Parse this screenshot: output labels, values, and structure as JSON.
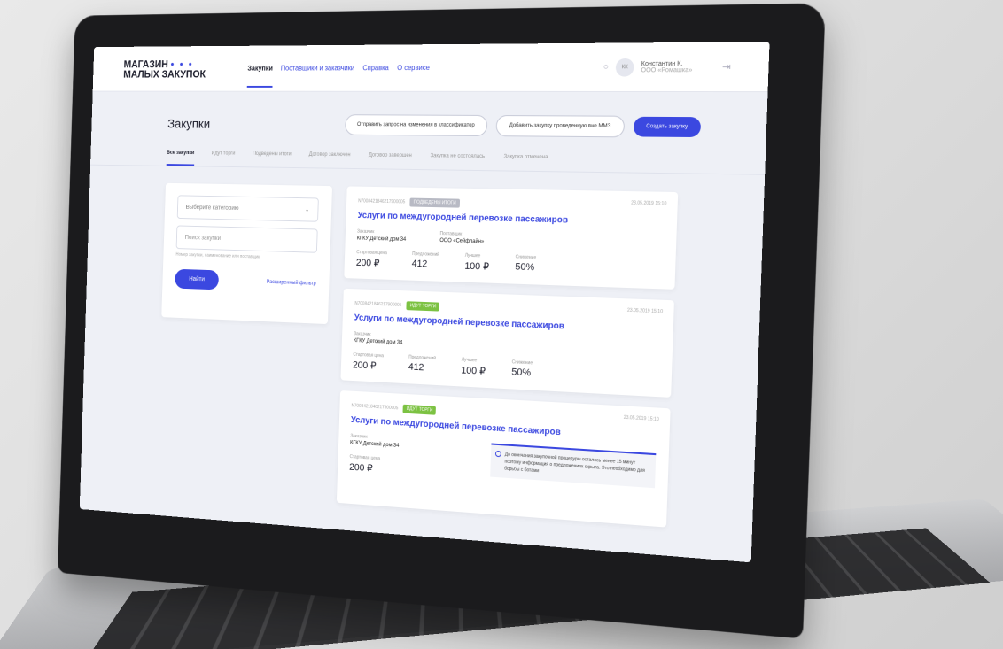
{
  "header": {
    "logo_line1": "МАГАЗИН",
    "logo_dots": "• • •",
    "logo_line2": "МАЛЫХ ЗАКУПОК",
    "nav": [
      "Закупки",
      "Поставщики и заказчики",
      "Справка",
      "О сервисе"
    ],
    "user_name": "Константин К.",
    "user_org": "ООО «Ромашка»",
    "avatar_initials": "КК"
  },
  "page": {
    "title": "Закупки",
    "btn_request": "Отправить запрос на изменения в классификатор",
    "btn_add": "Добавить закупку проведенную вне ММЗ",
    "btn_create": "Создать закупку"
  },
  "tabs": [
    "Все закупки",
    "Идут торги",
    "Подведены итоги",
    "Договор заключен",
    "Договор завершен",
    "Закупка не состоялась",
    "Закупка отменена"
  ],
  "filter": {
    "category_placeholder": "Выберите категорию",
    "search_placeholder": "Поиск закупки",
    "hint": "Номер закупки, наименование или поставщик",
    "find_label": "Найти",
    "advanced_label": "Расширенный фильтр"
  },
  "cards": [
    {
      "number": "N7008421846217900005",
      "status": "ПОДВЕДЕНЫ ИТОГИ",
      "date": "23.05.2019 15:10",
      "title": "Услуги по междугородней перевозке пассажиров",
      "customer_label": "Заказчик",
      "customer": "КГКУ Детский дом 34",
      "supplier_label": "Поставщик",
      "supplier": "ООО «Сейфлайн»",
      "start_label": "Стартовая цена",
      "start": "200 ₽",
      "offers_label": "Предложений",
      "offers": "412",
      "best_label": "Лучшее",
      "best": "100 ₽",
      "drop_label": "Снижение",
      "drop": "50%"
    },
    {
      "number": "N7008421846217900005",
      "status": "ИДУТ ТОРГИ",
      "date": "23.05.2019 15:10",
      "title": "Услуги по междугородней перевозке пассажиров",
      "customer_label": "Заказчик",
      "customer": "КГКУ Детский дом 34",
      "start_label": "Стартовая цена",
      "start": "200 ₽",
      "offers_label": "Предложений",
      "offers": "412",
      "best_label": "Лучшее",
      "best": "100 ₽",
      "drop_label": "Снижение",
      "drop": "50%"
    },
    {
      "number": "N7008421846217900005",
      "status": "ИДУТ ТОРГИ",
      "date": "23.05.2019 15:10",
      "title": "Услуги по междугородней перевозке пассажиров",
      "customer_label": "Заказчик",
      "customer": "КГКУ Детский дом 34",
      "start_label": "Стартовая цена",
      "start": "200 ₽",
      "notice": "До окончания закупочной процедуры осталось менее 15 минут поэтому информация о предложениях скрыта. Это необходимо для борьбы с ботами"
    }
  ],
  "colors": {
    "accent": "#3b48e0",
    "green": "#7cc242",
    "bg": "#eef0f6"
  }
}
